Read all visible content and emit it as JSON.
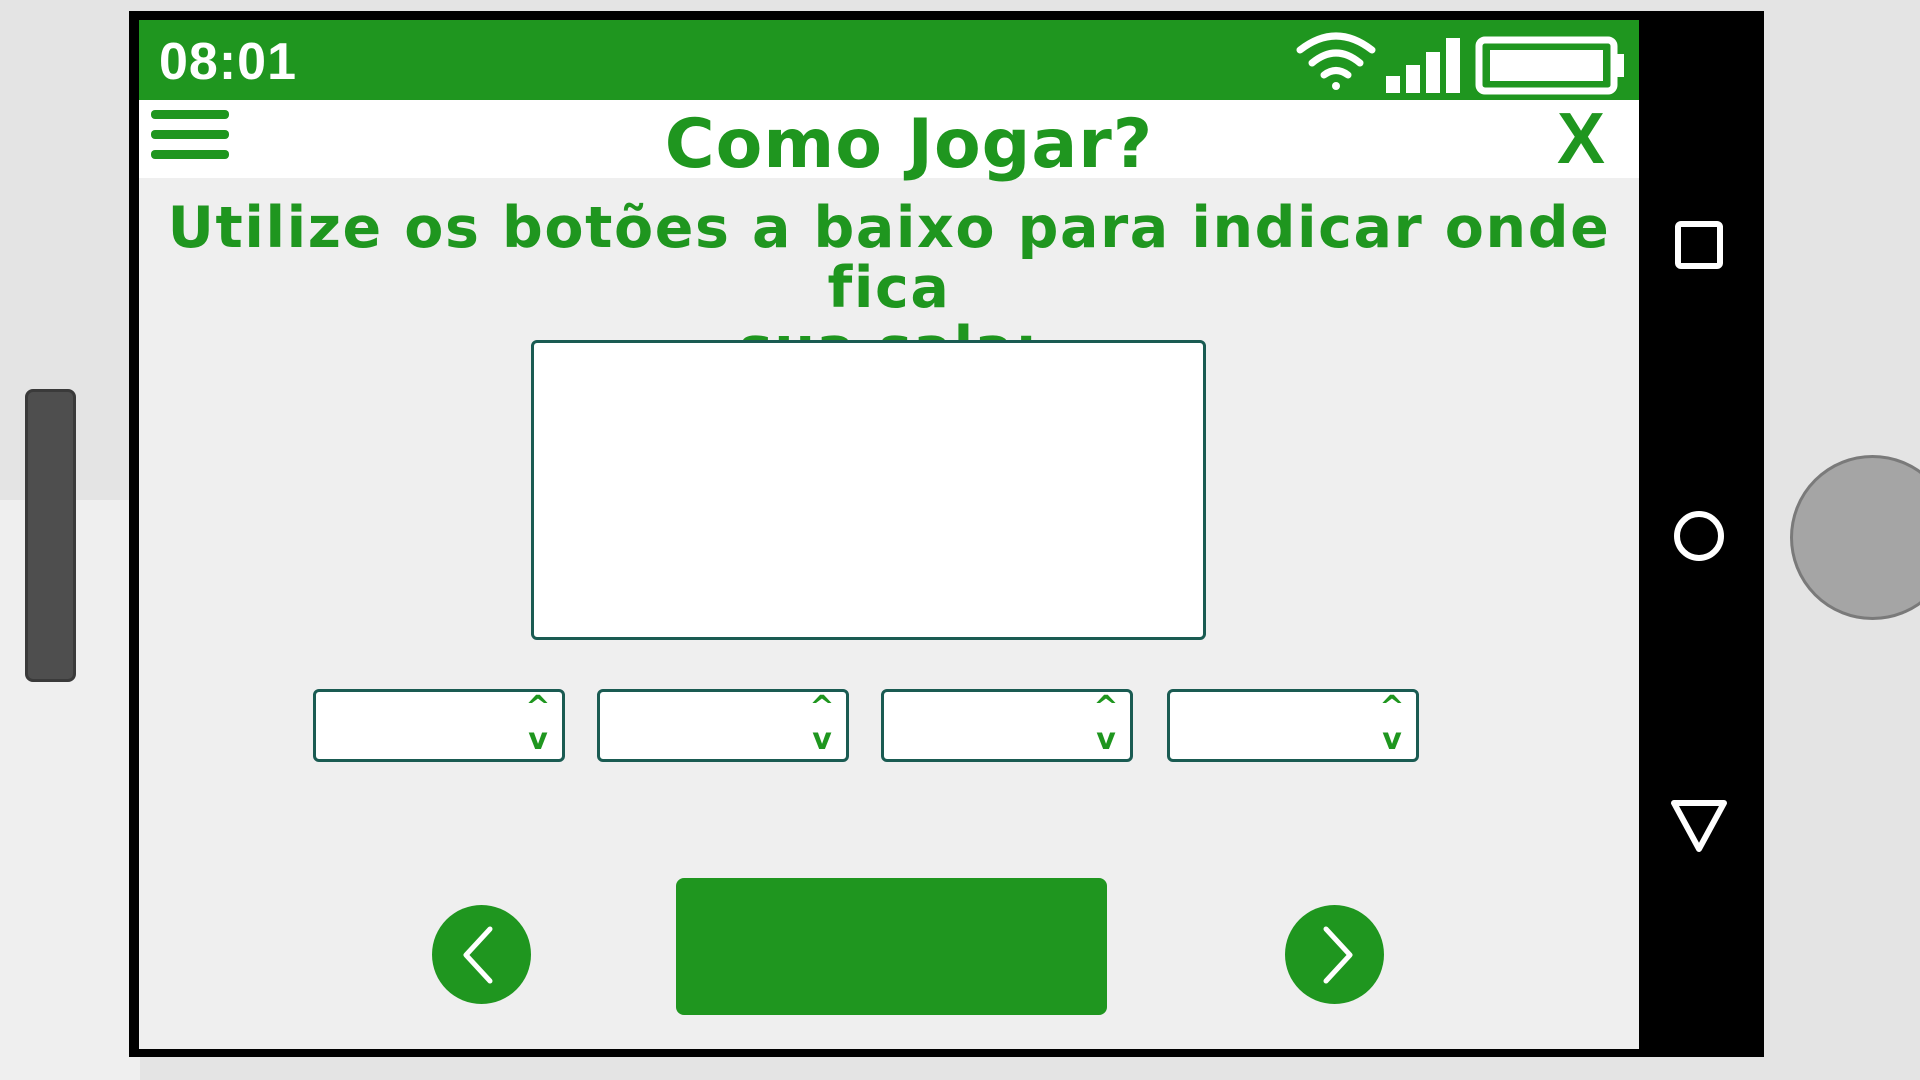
{
  "status_bar": {
    "time": "08:01",
    "icons": [
      "wifi-icon",
      "signal-icon",
      "battery-icon"
    ]
  },
  "app_bar": {
    "title": "Como Jogar?",
    "close_label": "X",
    "menu_icon": "hamburger-menu-icon"
  },
  "content": {
    "instruction_line1": "Utilize os botões a baixo para indicar onde fica",
    "instruction_line2": "sua sala:",
    "answer_box_value": "",
    "steppers": [
      {
        "value": "",
        "up": "^",
        "down": "v"
      },
      {
        "value": "",
        "up": "^",
        "down": "v"
      },
      {
        "value": "",
        "up": "^",
        "down": "v"
      },
      {
        "value": "",
        "up": "^",
        "down": "v"
      }
    ]
  },
  "navigation": {
    "prev_icon": "chevron-left-icon",
    "next_icon": "chevron-right-icon",
    "main_button_label": ""
  },
  "system_nav": [
    "recent-apps-icon",
    "home-icon",
    "back-icon"
  ],
  "colors": {
    "accent": "#1f961f",
    "border": "#1a5b52",
    "screen_bg": "#efefef",
    "frame": "#000000"
  }
}
